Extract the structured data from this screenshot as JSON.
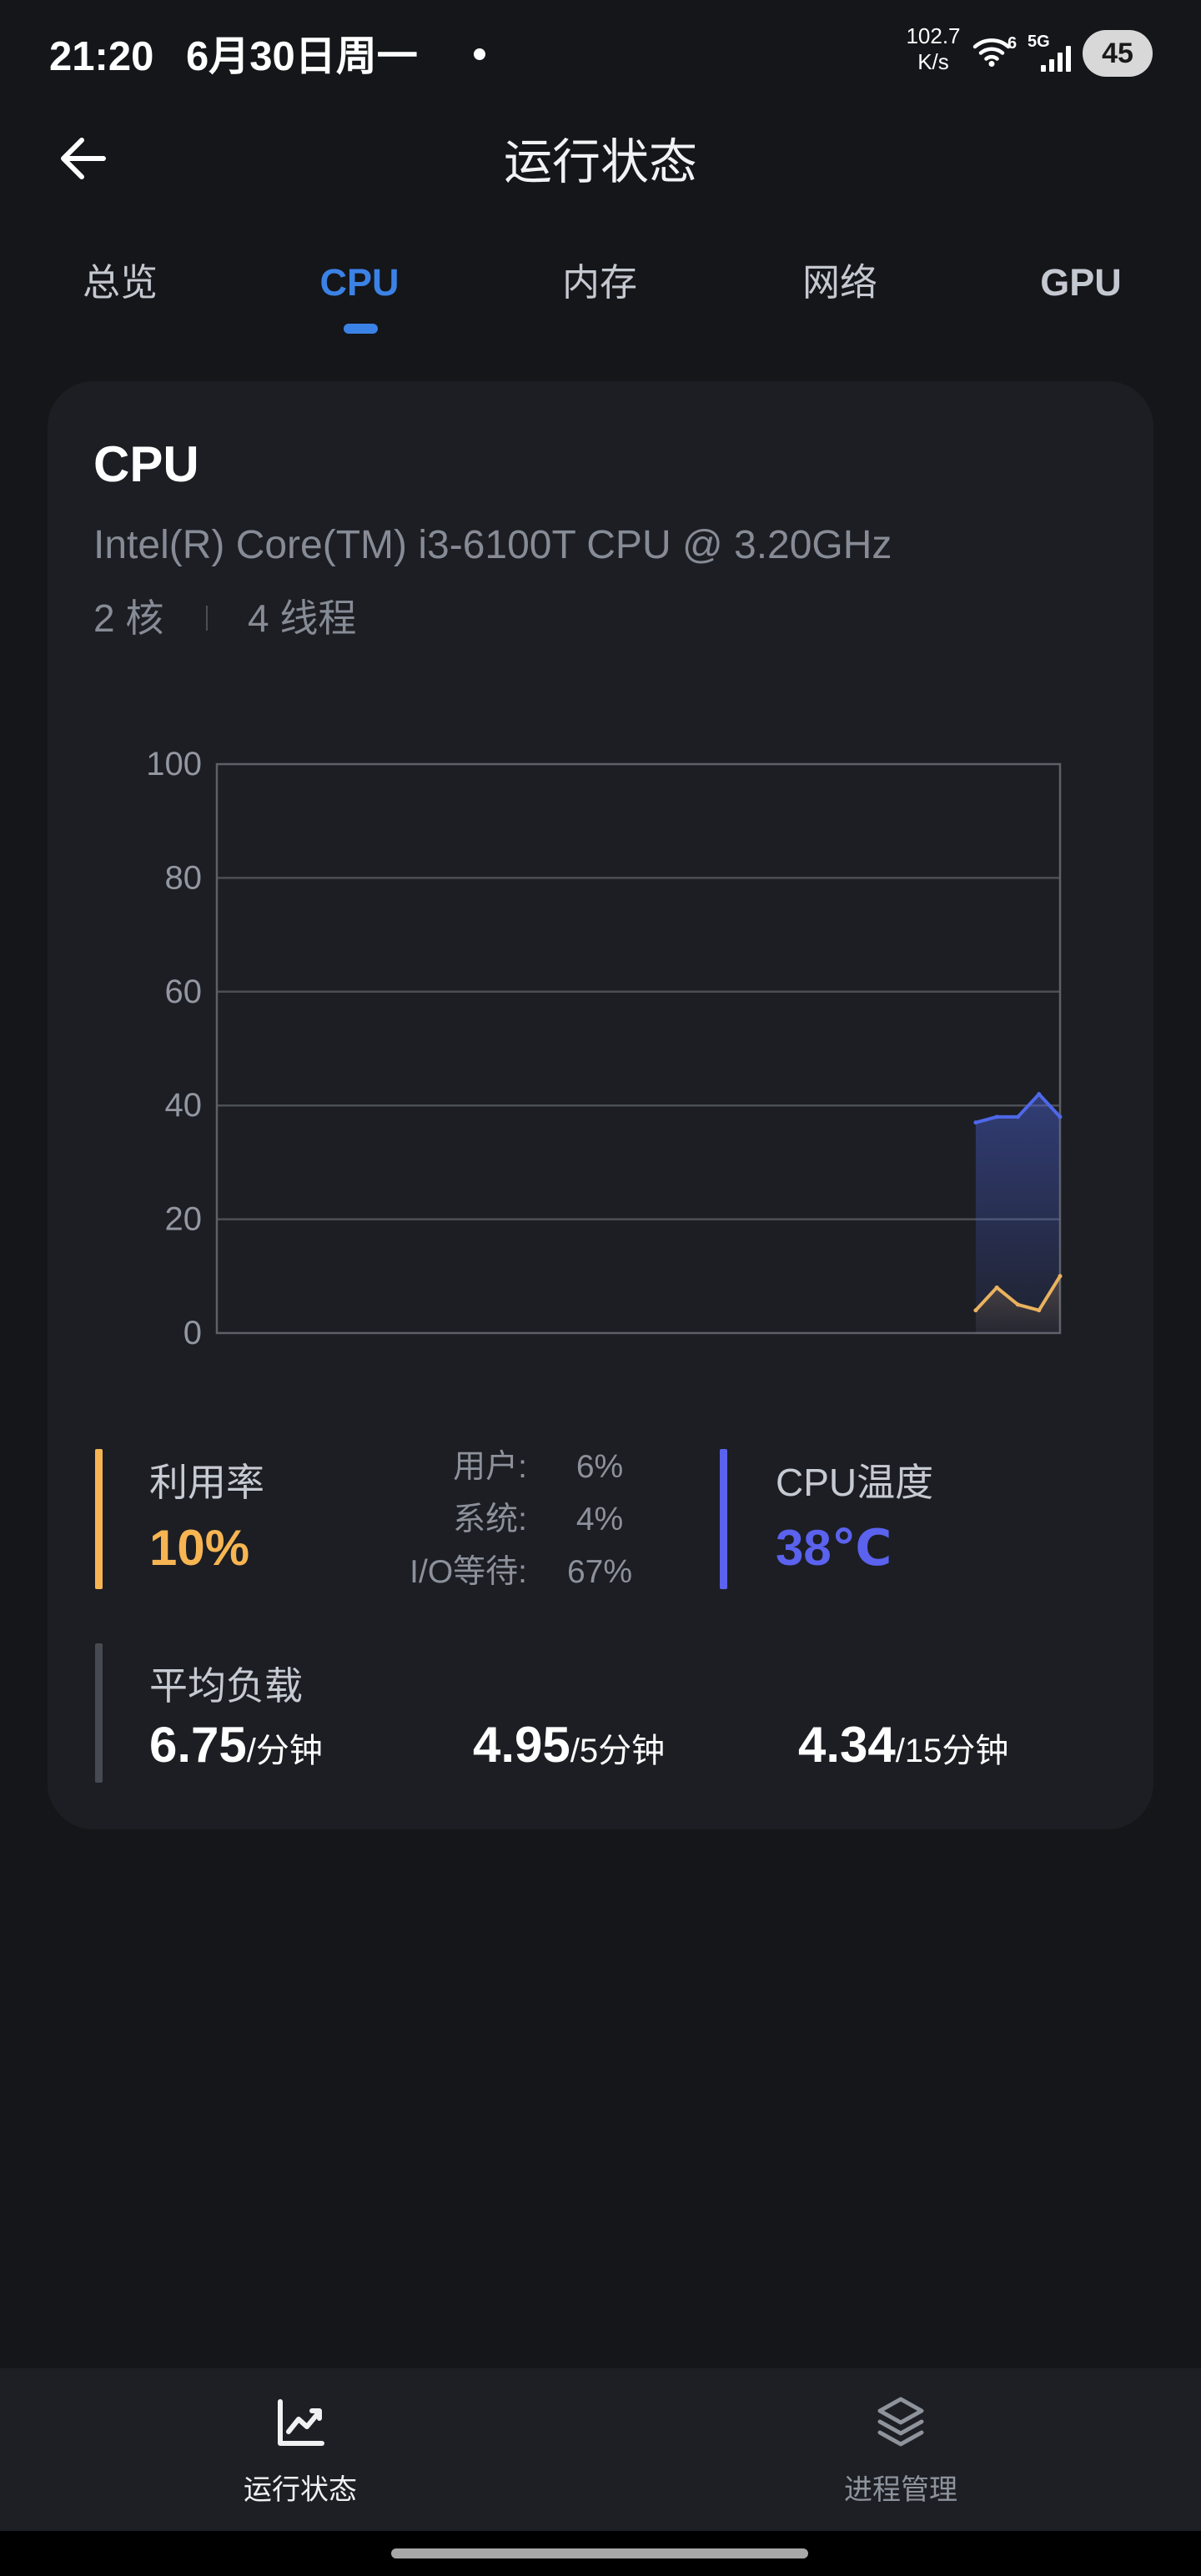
{
  "status_bar": {
    "time": "21:20",
    "date": "6月30日周一",
    "net_speed_value": "102.7",
    "net_speed_unit": "K/s",
    "wifi_badge": "6",
    "network_type": "5G",
    "battery_level": "45",
    "icons": {
      "notification": "notification-dot-icon",
      "wifi": "wifi-icon",
      "signal": "signal-icon",
      "battery": "battery-icon"
    }
  },
  "header": {
    "title": "运行状态",
    "back_icon": "arrow-left-icon"
  },
  "tabs": [
    {
      "label": "总览",
      "active": false
    },
    {
      "label": "CPU",
      "active": true
    },
    {
      "label": "内存",
      "active": false
    },
    {
      "label": "网络",
      "active": false
    },
    {
      "label": "GPU",
      "active": false
    }
  ],
  "cpu_card": {
    "title": "CPU",
    "model": "Intel(R) Core(TM) i3-6100T CPU @ 3.20GHz",
    "cores": "2 核",
    "threads": "4 线程",
    "usage": {
      "label": "利用率",
      "value": "10%"
    },
    "breakdown": [
      {
        "label": "用户:",
        "value": "6%"
      },
      {
        "label": "系统:",
        "value": "4%"
      },
      {
        "label": "I/O等待:",
        "value": "67%"
      }
    ],
    "temperature": {
      "label": "CPU温度",
      "value": "38℃"
    },
    "load_average": {
      "label": "平均负载",
      "items": [
        {
          "value": "6.75",
          "unit": "/分钟"
        },
        {
          "value": "4.95",
          "unit": "/5分钟"
        },
        {
          "value": "4.34",
          "unit": "/15分钟"
        }
      ]
    }
  },
  "chart_data": {
    "type": "area",
    "x": [
      36,
      37,
      38,
      39,
      40
    ],
    "xlim": [
      0,
      40
    ],
    "ylim": [
      0,
      100
    ],
    "y_ticks": [
      0,
      20,
      40,
      60,
      80,
      100
    ],
    "grid": true,
    "legend": "none",
    "series": [
      {
        "values": [
          37,
          38,
          38,
          42,
          38
        ],
        "color": "#4f68e8"
      },
      {
        "values": [
          4,
          8,
          5,
          4,
          10
        ],
        "color": "#eab25f"
      }
    ]
  },
  "bottom_nav": {
    "items": [
      {
        "label": "运行状态",
        "icon": "chart-line-icon",
        "active": true
      },
      {
        "label": "进程管理",
        "icon": "layers-icon",
        "active": false
      }
    ]
  },
  "colors": {
    "background": "#141619",
    "card": "#1c1e23",
    "accent": "#3b82e6",
    "usage": "#f6b552",
    "temperature": "#5a62ee",
    "load": "#474a51"
  }
}
